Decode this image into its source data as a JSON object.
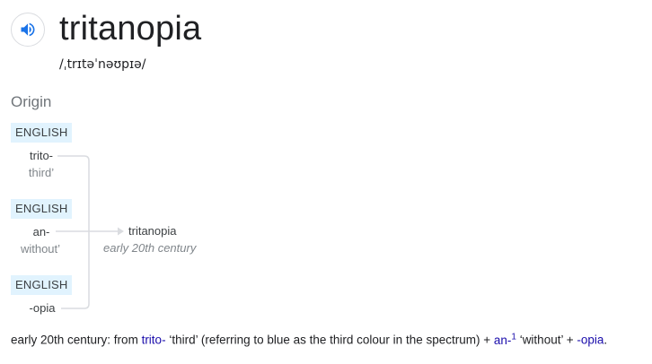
{
  "entry": {
    "headword": "tritanopia",
    "pronunciation": "/ˌtrɪtəˈnəʊpɪə/"
  },
  "origin": {
    "heading": "Origin",
    "components": [
      {
        "tag": "ENGLISH",
        "form": "trito-",
        "gloss": "third’"
      },
      {
        "tag": "ENGLISH",
        "form": "an-",
        "gloss": "without’"
      },
      {
        "tag": "ENGLISH",
        "form": "-opia",
        "gloss": ""
      }
    ],
    "result": {
      "form": "tritanopia",
      "date": "early 20th century"
    }
  },
  "etymology": {
    "lead": "early 20th century: from ",
    "link1": "trito-",
    "mid1": " ‘third’ (referring to blue as the third colour in the spectrum) + ",
    "link2": "an-",
    "sup": "1",
    "mid2": " ‘without’ + ",
    "link3": "-opia",
    "end": "."
  },
  "icons": {
    "speaker": "speaker-icon"
  },
  "colors": {
    "tag_bg": "#e1f3fe",
    "link": "#1a0dab",
    "line": "#dadce0",
    "speaker": "#1a73e8"
  }
}
